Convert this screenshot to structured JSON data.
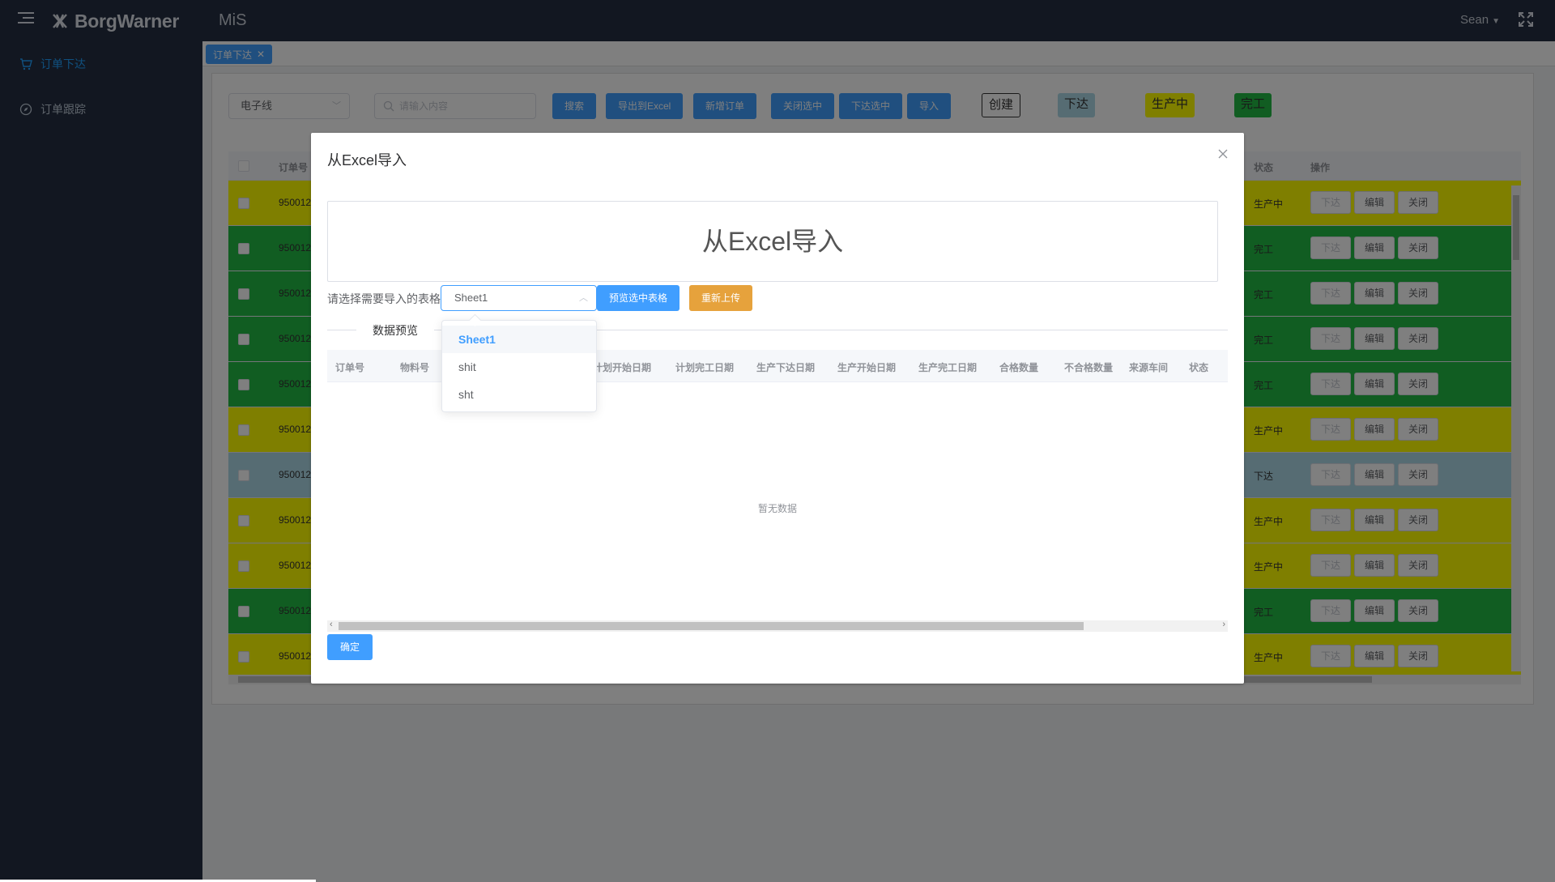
{
  "header": {
    "brand": "BorgWarner",
    "app_name": "MiS",
    "user": "Sean"
  },
  "sidebar": {
    "items": [
      {
        "label": "订单下达",
        "icon": "cart-icon",
        "active": true
      },
      {
        "label": "订单跟踪",
        "icon": "compass-icon",
        "active": false
      }
    ]
  },
  "tags": [
    {
      "label": "订单下达"
    }
  ],
  "toolbar": {
    "line_select": "电子线",
    "search_placeholder": "请输入内容",
    "buttons": [
      "搜索",
      "导出到Excel",
      "新增订单",
      "关闭选中",
      "下达选中",
      "导入"
    ],
    "legend": [
      {
        "label": "创建",
        "color": "#ffffff"
      },
      {
        "label": "下达",
        "color": "#add8e6"
      },
      {
        "label": "生产中",
        "color": "#ffff00"
      },
      {
        "label": "完工",
        "color": "#22bb44"
      }
    ]
  },
  "table": {
    "headers": {
      "order_no": "订单号",
      "status": "状态",
      "actions": "操作"
    },
    "action_labels": {
      "release": "下达",
      "edit": "编辑",
      "close": "关闭"
    },
    "rows": [
      {
        "order_no": "950012",
        "status": "生产中",
        "color": "#ffff00"
      },
      {
        "order_no": "950012",
        "status": "完工",
        "color": "#22bb44"
      },
      {
        "order_no": "950012",
        "status": "完工",
        "color": "#22bb44"
      },
      {
        "order_no": "950012",
        "status": "完工",
        "color": "#22bb44"
      },
      {
        "order_no": "950012",
        "status": "完工",
        "color": "#22bb44"
      },
      {
        "order_no": "950012",
        "status": "生产中",
        "color": "#ffff00"
      },
      {
        "order_no": "950012",
        "status": "下达",
        "color": "#add8e6"
      },
      {
        "order_no": "950012",
        "status": "生产中",
        "color": "#ffff00"
      },
      {
        "order_no": "950012",
        "status": "生产中",
        "color": "#ffff00"
      },
      {
        "order_no": "950012",
        "status": "完工",
        "color": "#22bb44"
      },
      {
        "order_no": "950012",
        "status": "生产中",
        "color": "#ffff00"
      }
    ]
  },
  "dialog": {
    "title": "从Excel导入",
    "banner": "从Excel导入",
    "choose_label": "请选择需要导入的表格",
    "selected_sheet": "Sheet1",
    "preview_button": "预览选中表格",
    "reupload_button": "重新上传",
    "divider_label": "数据预览",
    "preview_headers": [
      "订单号",
      "物料号",
      "计划开始日期",
      "计划完工日期",
      "生产下达日期",
      "生产开始日期",
      "生产完工日期",
      "合格数量",
      "不合格数量",
      "来源车间",
      "状态"
    ],
    "empty_text": "暂无数据",
    "ok_button": "确定",
    "sheet_options": [
      "Sheet1",
      "shit",
      "sht"
    ]
  }
}
